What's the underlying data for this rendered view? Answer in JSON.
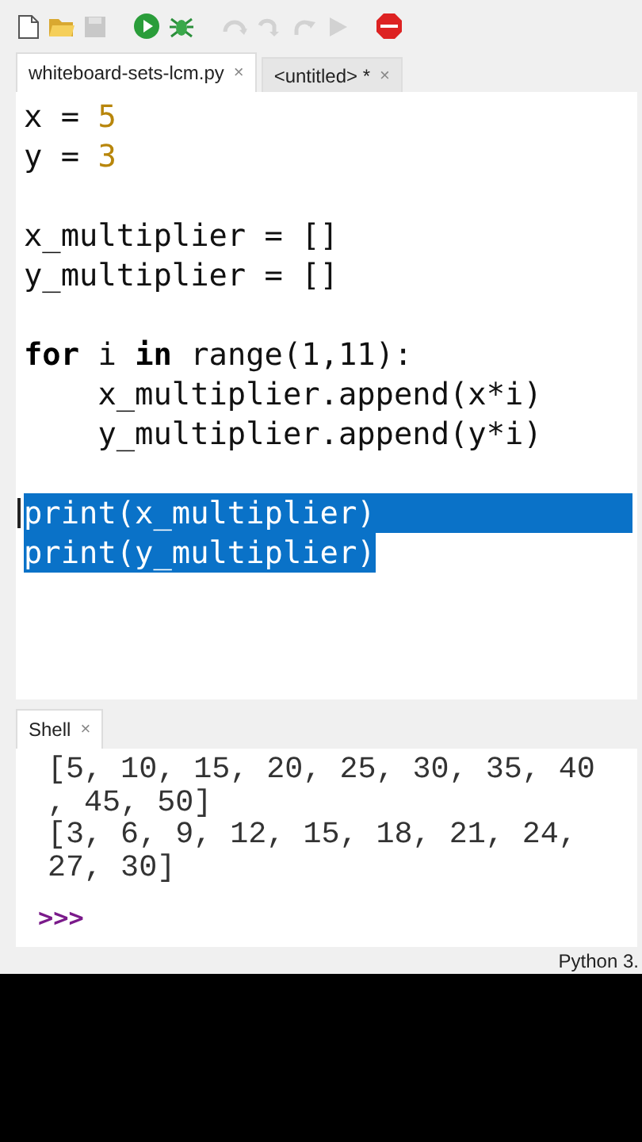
{
  "toolbar": [
    {
      "kind": "new",
      "disabled": false
    },
    {
      "kind": "open",
      "disabled": false
    },
    {
      "kind": "save",
      "disabled": true
    },
    {
      "kind": "run",
      "disabled": false
    },
    {
      "kind": "debug",
      "disabled": false
    },
    {
      "kind": "step-over",
      "disabled": true
    },
    {
      "kind": "step-into",
      "disabled": true
    },
    {
      "kind": "step-out",
      "disabled": true
    },
    {
      "kind": "resume",
      "disabled": true
    },
    {
      "kind": "stop",
      "disabled": false
    }
  ],
  "tabs": [
    {
      "label": "whiteboard-sets-lcm.py",
      "close": "×",
      "selected": true
    },
    {
      "label": "<untitled> *",
      "close": "×",
      "selected": false
    }
  ],
  "editor": {
    "lines": [
      {
        "kind": "code",
        "selected": false,
        "tokens": [
          {
            "kind": "plain",
            "text": "x = "
          },
          {
            "kind": "num",
            "text": "5"
          }
        ]
      },
      {
        "kind": "code",
        "selected": false,
        "tokens": [
          {
            "kind": "plain",
            "text": "y = "
          },
          {
            "kind": "num",
            "text": "3"
          }
        ]
      },
      {
        "kind": "blank"
      },
      {
        "kind": "code",
        "selected": false,
        "tokens": [
          {
            "kind": "plain",
            "text": "x_multiplier = []"
          }
        ]
      },
      {
        "kind": "code",
        "selected": false,
        "tokens": [
          {
            "kind": "plain",
            "text": "y_multiplier = []"
          }
        ]
      },
      {
        "kind": "blank"
      },
      {
        "kind": "code",
        "selected": false,
        "tokens": [
          {
            "kind": "kw",
            "text": "for"
          },
          {
            "kind": "plain",
            "text": " i "
          },
          {
            "kind": "kw",
            "text": "in"
          },
          {
            "kind": "plain",
            "text": " range(1,11):"
          }
        ]
      },
      {
        "kind": "code",
        "selected": false,
        "tokens": [
          {
            "kind": "plain",
            "text": "    x_multiplier.append(x*i)"
          }
        ]
      },
      {
        "kind": "code",
        "selected": false,
        "tokens": [
          {
            "kind": "plain",
            "text": "    y_multiplier.append(y*i)"
          }
        ]
      },
      {
        "kind": "blank"
      },
      {
        "kind": "code",
        "selected": true,
        "selected_to_end": true,
        "cursor": true,
        "tokens": [
          {
            "kind": "plain",
            "text": "print(x_multiplier)"
          }
        ]
      },
      {
        "kind": "code",
        "selected": true,
        "selected_to_end": false,
        "tokens": [
          {
            "kind": "plain",
            "text": "print(y_multiplier)"
          }
        ]
      }
    ]
  },
  "shell": {
    "tab": {
      "label": "Shell",
      "close": "×",
      "selected": true
    },
    "output": [
      "[5, 10, 15, 20, 25, 30, 35, 40",
      ", 45, 50]",
      "[3, 6, 9, 12, 15, 18, 21, 24,",
      "27, 30]"
    ],
    "prompt": ">>>"
  },
  "status_bar": {
    "text": "Python 3."
  }
}
